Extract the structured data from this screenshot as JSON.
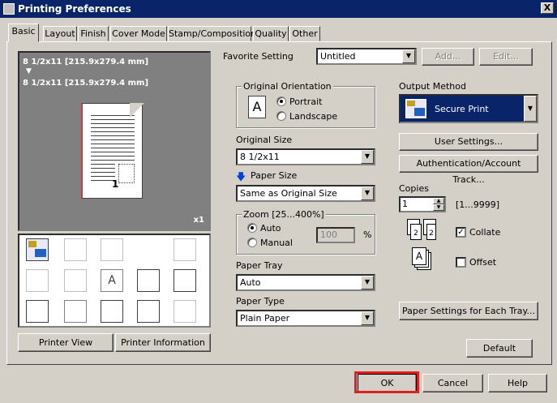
{
  "window": {
    "title": "Printing Preferences",
    "close_label": "X"
  },
  "tabs": [
    "Basic",
    "Layout",
    "Finish",
    "Cover Mode",
    "Stamp/Composition",
    "Quality",
    "Other"
  ],
  "preview": {
    "line1": "8 1/2x11 [215.9x279.4 mm]",
    "arrow": "▼",
    "line2": "8 1/2x11 [215.9x279.4 mm]",
    "page_number": "1",
    "scale": "x1"
  },
  "favorite": {
    "label": "Favorite Setting",
    "value": "Untitled",
    "add_label": "Add...",
    "edit_label": "Edit..."
  },
  "orientation": {
    "label": "Original Orientation",
    "portrait": "Portrait",
    "landscape": "Landscape",
    "icon_letter": "A"
  },
  "original_size": {
    "label": "Original Size",
    "value": "8 1/2x11"
  },
  "paper_size": {
    "label": "Paper Size",
    "value": "Same as Original Size"
  },
  "zoom": {
    "label": "Zoom [25...400%]",
    "auto": "Auto",
    "manual": "Manual",
    "value": "100",
    "unit": "%"
  },
  "paper_tray": {
    "label": "Paper Tray",
    "value": "Auto"
  },
  "paper_type": {
    "label": "Paper Type",
    "value": "Plain Paper"
  },
  "output_method": {
    "label": "Output Method",
    "value": "Secure Print"
  },
  "buttons": {
    "user_settings": "User Settings...",
    "authentication": "Authentication/Account Track...",
    "paper_settings_tray": "Paper Settings for Each Tray...",
    "default": "Default",
    "printer_view": "Printer View",
    "printer_information": "Printer Information",
    "ok": "OK",
    "cancel": "Cancel",
    "help": "Help"
  },
  "copies": {
    "label": "Copies",
    "value": "1",
    "range": "[1...9999]"
  },
  "collate": {
    "label": "Collate",
    "checked": true
  },
  "offset": {
    "label": "Offset",
    "checked": false
  },
  "icons": [
    "secure-print-icon",
    "staple-icon",
    "duplex-icon",
    "punch-icon",
    "booklet-icon",
    "combination-icon",
    "watermark-icon",
    "overlay-icon",
    "copy-protect-icon",
    "cover-sheet-icon",
    "account-icon",
    "user-auth-icon",
    "date-time-icon",
    "page-number-icon"
  ],
  "colors": {
    "titlebar": "#0a246a",
    "highlight": "#e02020",
    "selected": "#0a246a"
  }
}
